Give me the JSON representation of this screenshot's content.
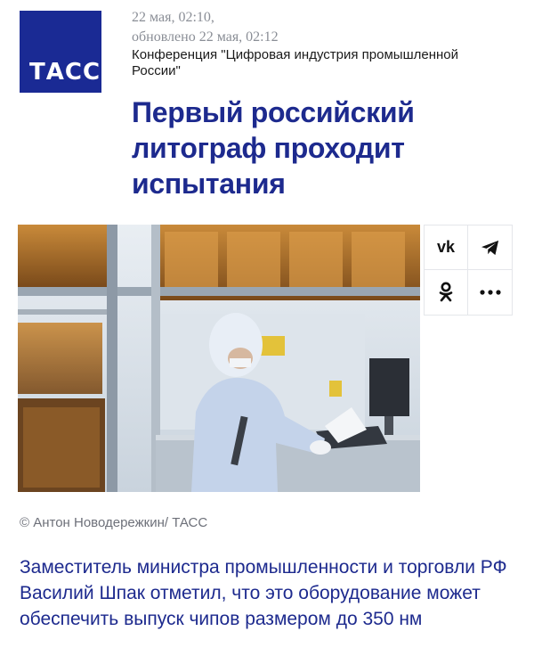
{
  "brand": {
    "logo_text": "ТАСС"
  },
  "meta": {
    "date": "22 мая, 02:10,",
    "updated": "обновлено 22 мая, 02:12",
    "conference": "Конференция \"Цифровая индустрия промышленной России\""
  },
  "article": {
    "headline": "Первый российский литограф проходит испытания",
    "photo_credit": "© Антон Новодережкин/ ТАСС",
    "lead": "Заместитель министра промышленности и торговли РФ Василий Шпак отметил, что это оборудование может обеспечить выпуск чипов размером до 350 нм"
  },
  "share": {
    "items": [
      {
        "icon": "vk-icon",
        "glyph": "vk"
      },
      {
        "icon": "telegram-icon",
        "glyph": ""
      },
      {
        "icon": "odnoklassniki-icon",
        "glyph": ""
      },
      {
        "icon": "more-icon",
        "glyph": ""
      }
    ]
  },
  "colors": {
    "brand_blue": "#1a2a94",
    "headline": "#1d2a8e",
    "meta_gray": "#8a8e96"
  }
}
